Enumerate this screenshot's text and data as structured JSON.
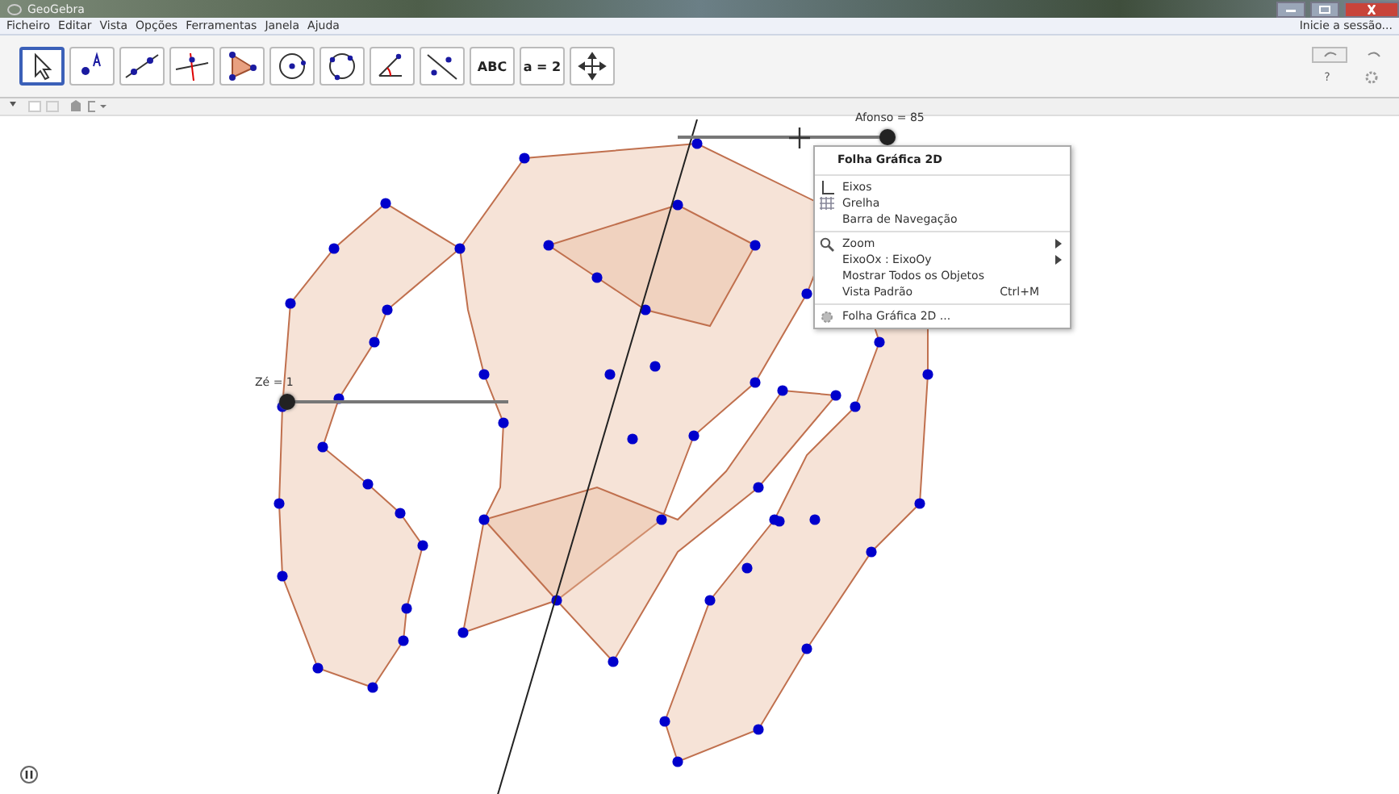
{
  "window": {
    "title": "GeoGebra"
  },
  "menu": [
    "Ficheiro",
    "Editar",
    "Vista",
    "Opções",
    "Ferramentas",
    "Janela",
    "Ajuda"
  ],
  "login": "Inicie a sessão...",
  "tools": [
    {
      "kind": "pointer",
      "selected": true
    },
    {
      "kind": "point",
      "selected": false
    },
    {
      "kind": "line",
      "selected": false
    },
    {
      "kind": "perpendicular",
      "selected": false
    },
    {
      "kind": "polygon",
      "selected": false
    },
    {
      "kind": "circle",
      "selected": false
    },
    {
      "kind": "circle3",
      "selected": false
    },
    {
      "kind": "angle",
      "selected": false
    },
    {
      "kind": "reflect",
      "selected": false
    },
    {
      "label": "ABC",
      "selected": false
    },
    {
      "label": "a = 2",
      "selected": false
    },
    {
      "kind": "move",
      "selected": false
    }
  ],
  "help": "?",
  "sliders": [
    {
      "label": "Zé = 1",
      "level": 0
    },
    {
      "label": "Afonso = 85",
      "level": 1
    }
  ],
  "context_menu": {
    "title": "Folha Gráfica 2D",
    "sections": [
      [
        {
          "label": "Eixos",
          "kind": "axes"
        },
        {
          "label": "Grelha",
          "kind": "grid"
        },
        {
          "label": "Barra de Navegação",
          "kind": "plain"
        }
      ],
      [
        {
          "label": "Zoom",
          "kind": "zoom",
          "submenu": true
        },
        {
          "label": "EixoOx : EixoOy",
          "kind": "plain",
          "submenu": true
        },
        {
          "label": "Mostrar Todos os Objetos",
          "kind": "plain"
        },
        {
          "label": "Vista Padrão",
          "kind": "plain",
          "shortcut": "Ctrl+M"
        }
      ],
      [
        {
          "label": "Folha Gráfica 2D ...",
          "kind": "gear"
        }
      ]
    ]
  }
}
